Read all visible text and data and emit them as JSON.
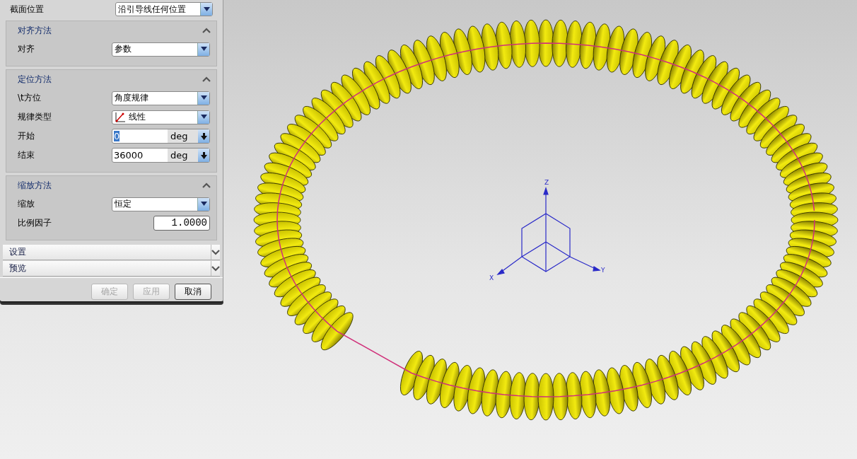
{
  "section_position": {
    "label": "截面位置",
    "value": "沿引导线任何位置"
  },
  "groups": [
    {
      "title": "对齐方法",
      "expanded": true,
      "rows": [
        {
          "kind": "dropdown",
          "label": "对齐",
          "value": "参数"
        }
      ]
    },
    {
      "title": "定位方法",
      "expanded": true,
      "rows": [
        {
          "kind": "dropdown",
          "label": "\\t方位",
          "value": "角度规律"
        },
        {
          "kind": "law-dropdown",
          "label": "规律类型",
          "value": "线性"
        },
        {
          "kind": "unit-field",
          "label": "开始",
          "value": "0",
          "unit": "deg",
          "highlighted": true
        },
        {
          "kind": "unit-field",
          "label": "结束",
          "value": "36000",
          "unit": "deg",
          "highlighted": false
        }
      ]
    },
    {
      "title": "缩放方法",
      "expanded": true,
      "rows": [
        {
          "kind": "dropdown",
          "label": "缩放",
          "value": "恒定"
        },
        {
          "kind": "number-field",
          "label": "比例因子",
          "value": "1.0000"
        }
      ]
    },
    {
      "title": "设置",
      "expanded": false
    },
    {
      "title": "预览",
      "expanded": false
    }
  ],
  "buttons": [
    {
      "label": "确定",
      "disabled": true
    },
    {
      "label": "应用",
      "disabled": true
    },
    {
      "label": "取消",
      "disabled": false
    }
  ],
  "triad": {
    "z": "Z",
    "y": "Y",
    "x": "X"
  }
}
